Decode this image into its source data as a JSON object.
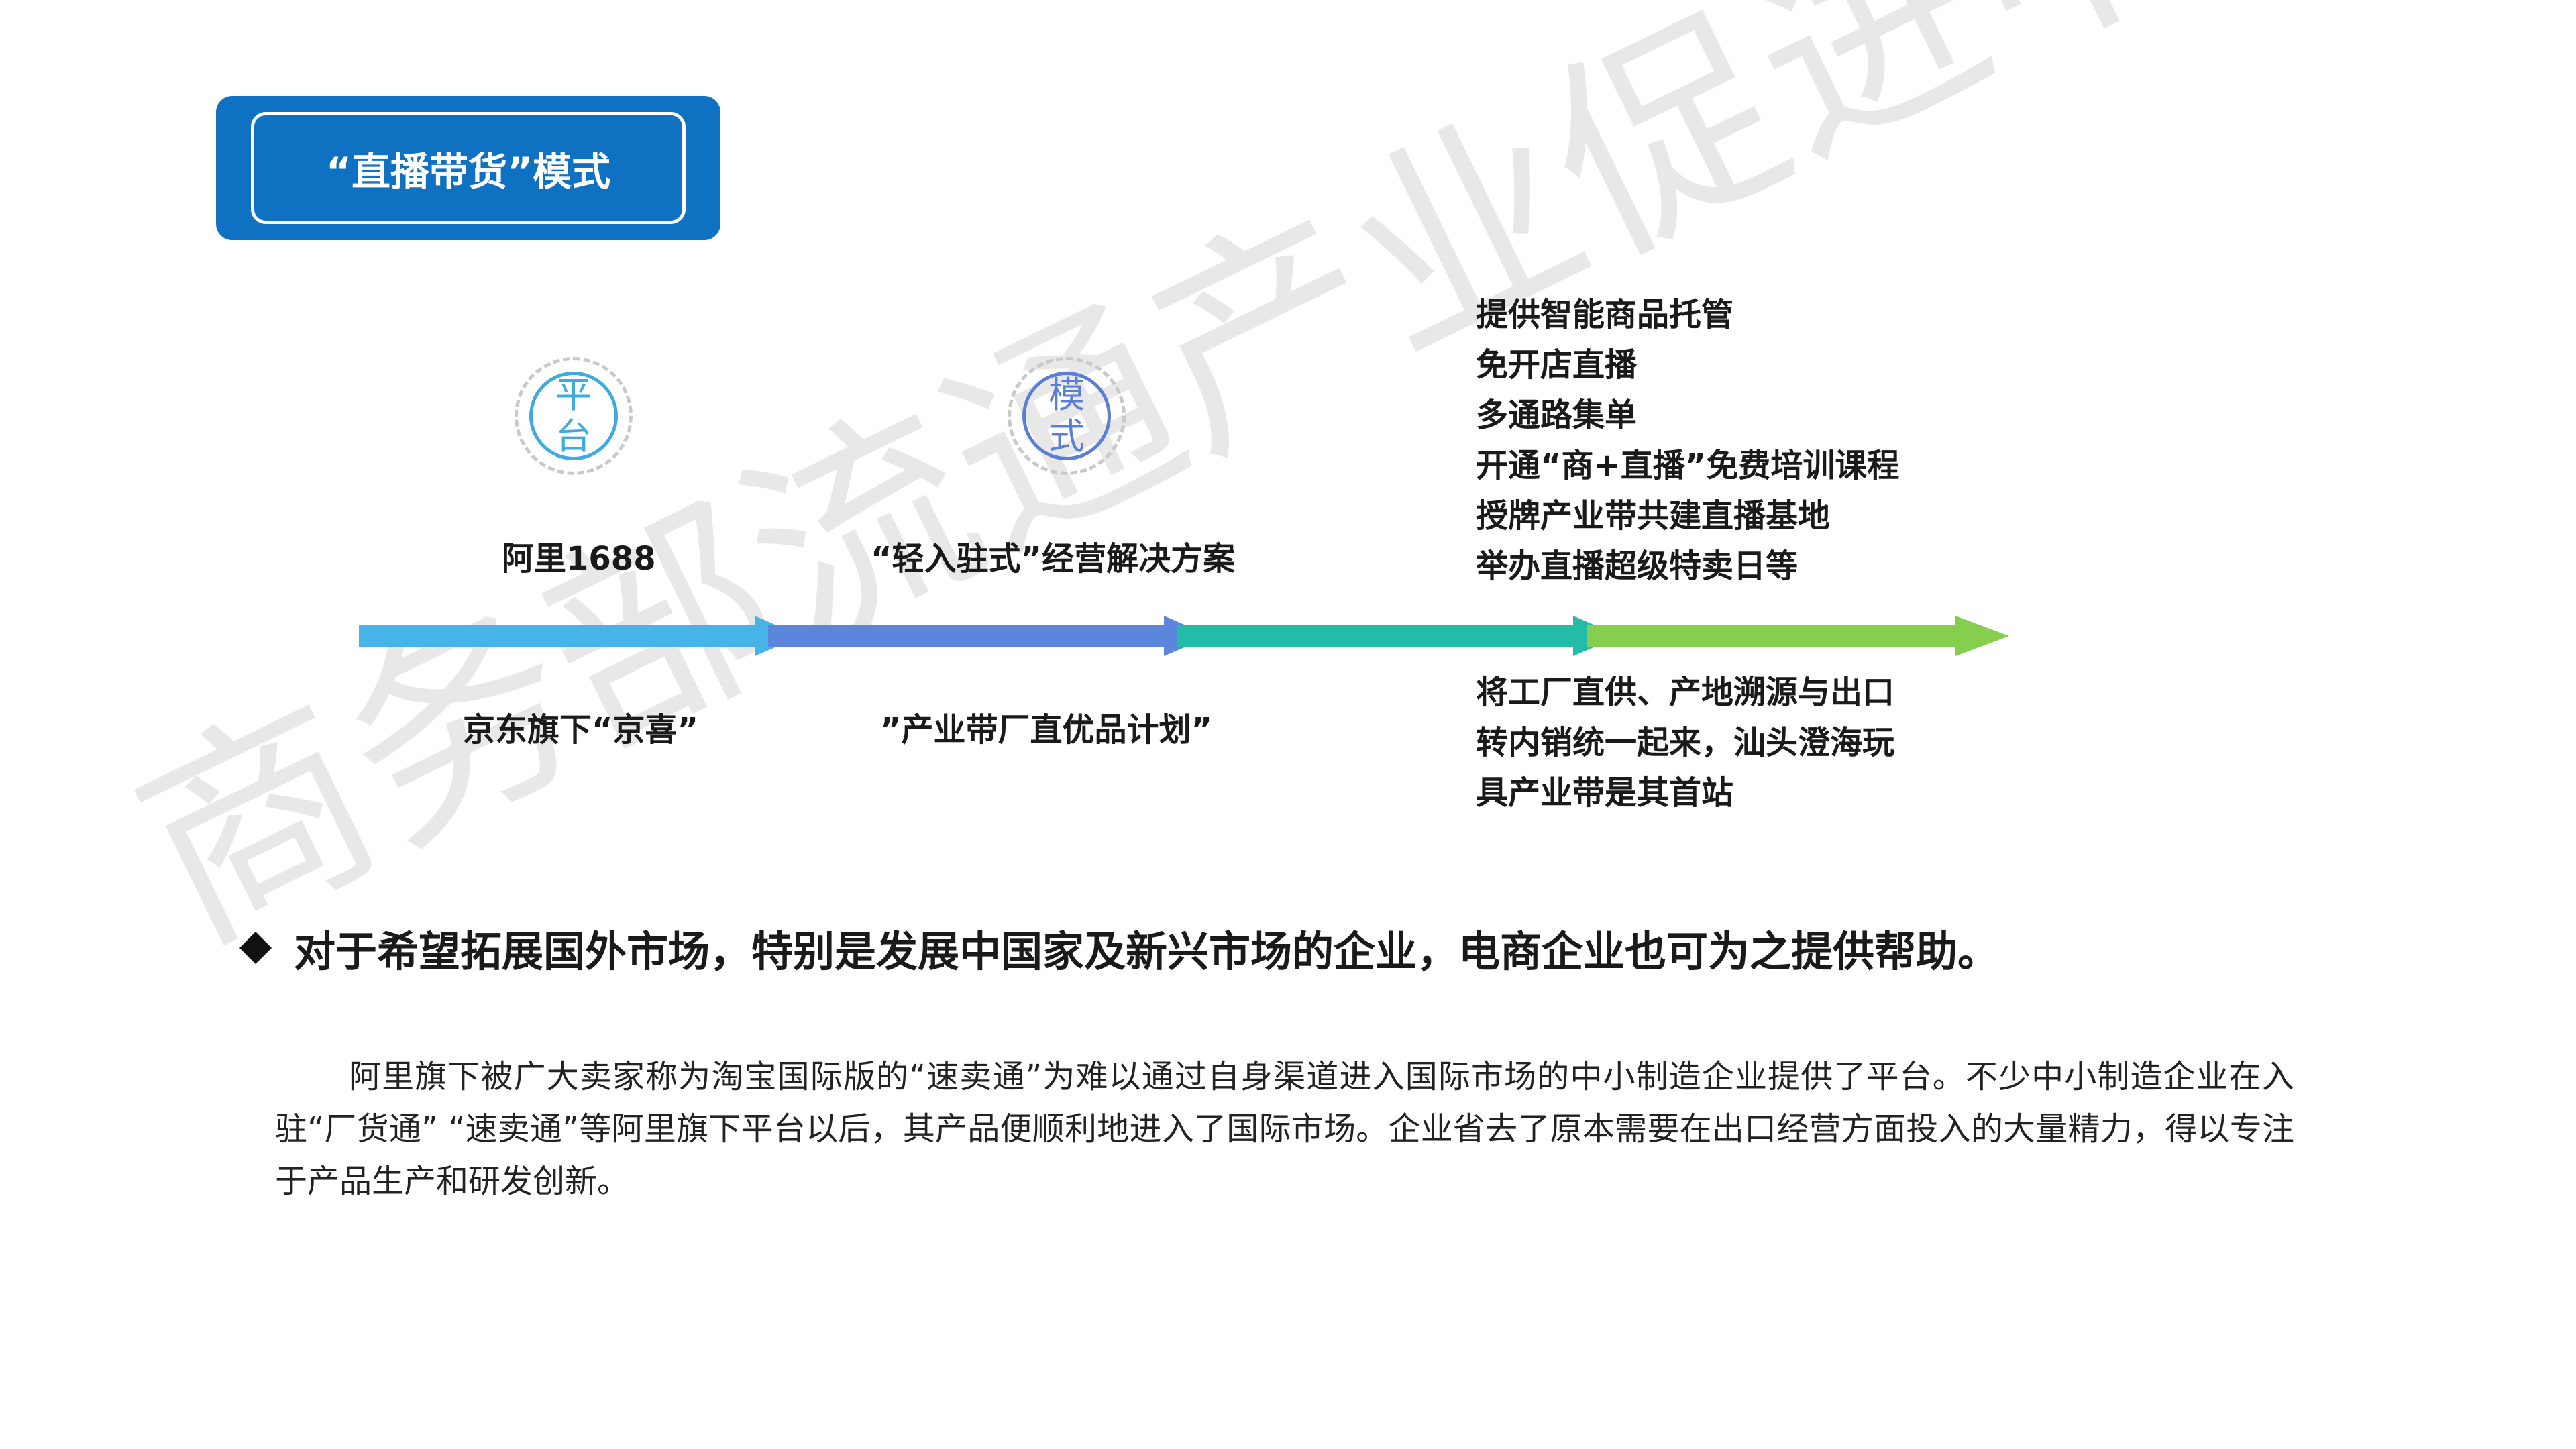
{
  "watermark": "商务部流通产业促进中心",
  "title": "“直播带货”模式",
  "badges": {
    "platform": {
      "text": "平台",
      "color": "#3fa9e0"
    },
    "mode": {
      "text": "模式",
      "color": "#5b7fd8"
    }
  },
  "top_labels": {
    "alibaba": "阿里1688",
    "solution": "“轻入驻式”经营解决方案"
  },
  "bottom_labels": {
    "jd": "京东旗下“京喜”",
    "plan": "”产业带厂直优品计划”"
  },
  "services": [
    "提供智能商品托管",
    "免开店直播",
    "多通路集单",
    "开通“商+直播”免费培训课程",
    "授牌产业带共建直播基地",
    "举办直播超级特卖日等"
  ],
  "outcomes": [
    "将工厂直供、产地溯源与出口",
    "转内销统一起来，汕头澄海玩",
    "具产业带是其首站"
  ],
  "timeline_colors": [
    "#46b4e6",
    "#5b86dc",
    "#23bca9",
    "#86cf4e"
  ],
  "bullet": "对于希望拓展国外市场，特别是发展中国家及新兴市场的企业，电商企业也可为之提供帮助。",
  "paragraph": "阿里旗下被广大卖家称为淘宝国际版的“速卖通”为难以通过自身渠道进入国际市场的中小制造企业提供了平台。不少中小制造企业在入驻“厂货通” “速卖通”等阿里旗下平台以后，其产品便顺利地进入了国际市场。企业省去了原本需要在出口经营方面投入的大量精力，得以专注于产品生产和研发创新。"
}
